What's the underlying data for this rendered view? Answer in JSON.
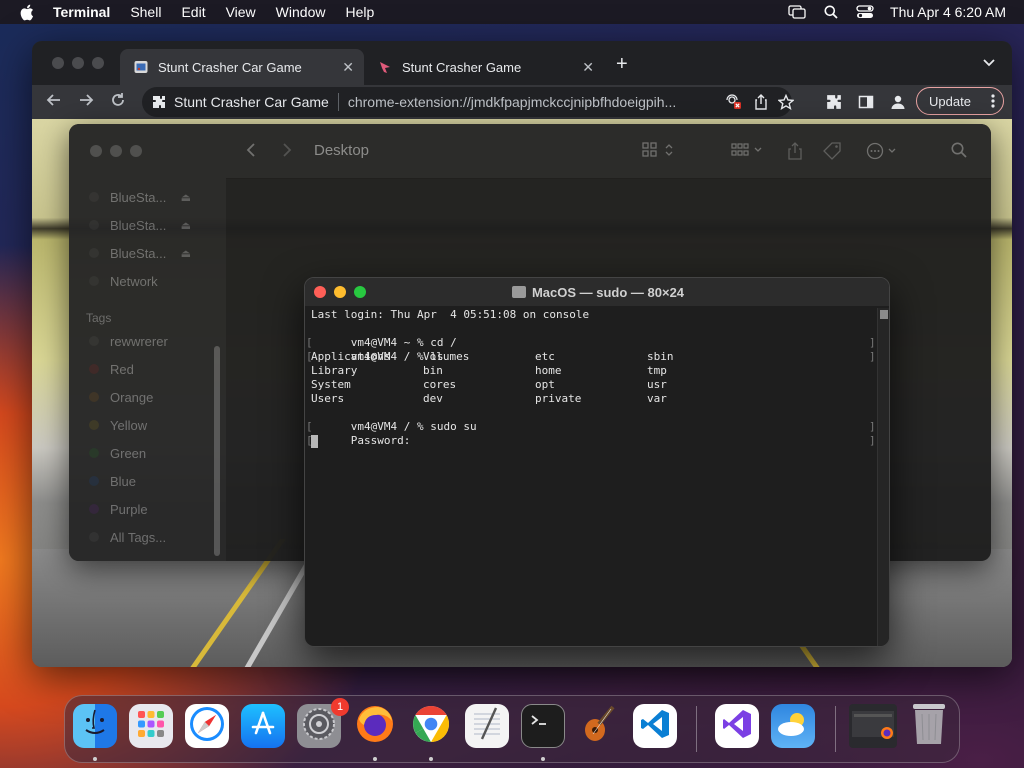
{
  "menubar": {
    "app_name": "Terminal",
    "items": [
      "Shell",
      "Edit",
      "View",
      "Window",
      "Help"
    ],
    "clock": "Thu Apr 4  6:20 AM",
    "icons": [
      "apple-icon",
      "screen-mirroring-icon",
      "search-icon",
      "control-center-icon"
    ]
  },
  "browser": {
    "tabs": [
      {
        "title": "Stunt Crasher Car Game",
        "active": true
      },
      {
        "title": "Stunt Crasher Game",
        "active": false
      }
    ],
    "site_name": "Stunt Crasher Car Game",
    "url": "chrome-extension://jmdkfpapjmckccjnipbfhdoeigpih...",
    "update_label": "Update"
  },
  "finder": {
    "title": "Desktop",
    "locations": [
      {
        "label": "BlueSta..."
      },
      {
        "label": "BlueSta..."
      },
      {
        "label": "BlueSta..."
      },
      {
        "label": "Network"
      }
    ],
    "tags_header": "Tags",
    "tags": [
      {
        "label": "rewwrerer",
        "color": "#2f2f2f"
      },
      {
        "label": "Red",
        "color": "#3a2424"
      },
      {
        "label": "Orange",
        "color": "#3a2f22"
      },
      {
        "label": "Yellow",
        "color": "#393522"
      },
      {
        "label": "Green",
        "color": "#233424"
      },
      {
        "label": "Blue",
        "color": "#222c3a"
      },
      {
        "label": "Purple",
        "color": "#312338"
      },
      {
        "label": "All Tags...",
        "color": "#2f2f2f"
      }
    ]
  },
  "terminal": {
    "title": "MacOS — sudo — 80×24",
    "lines": [
      "Last login: Thu Apr  4 05:51:08 on console",
      "vm4@VM4 ~ % cd /",
      "vm4@VM4 / % ls"
    ],
    "ls_output": [
      [
        "Applications",
        "Volumes",
        "etc",
        "sbin"
      ],
      [
        "Library",
        "bin",
        "home",
        "tmp"
      ],
      [
        "System",
        "cores",
        "opt",
        "usr"
      ],
      [
        "Users",
        "dev",
        "private",
        "var"
      ]
    ],
    "after_lines": [
      "vm4@VM4 / % sudo su",
      "Password:"
    ]
  },
  "dock": {
    "apps": [
      {
        "name": "Finder",
        "icon": "finder-icon",
        "running": true
      },
      {
        "name": "Launchpad",
        "icon": "launchpad-icon",
        "running": false
      },
      {
        "name": "Safari",
        "icon": "safari-icon",
        "running": false
      },
      {
        "name": "App Store",
        "icon": "app-store-icon",
        "running": false
      },
      {
        "name": "System Settings",
        "icon": "settings-icon",
        "running": false,
        "badge": "1"
      },
      {
        "name": "Firefox",
        "icon": "firefox-icon",
        "running": true
      },
      {
        "name": "Chrome",
        "icon": "chrome-icon",
        "running": true
      },
      {
        "name": "TextEdit",
        "icon": "textedit-icon",
        "running": false
      },
      {
        "name": "Terminal",
        "icon": "terminal-icon",
        "running": true
      },
      {
        "name": "GarageBand",
        "icon": "garageband-icon",
        "running": false
      },
      {
        "name": "Visual Studio Code",
        "icon": "vscode-icon",
        "running": false
      },
      {
        "name": "Visual Studio",
        "icon": "visual-studio-icon",
        "running": false
      },
      {
        "name": "Weather",
        "icon": "weather-icon",
        "running": false
      },
      {
        "name": "Minimized Window",
        "icon": "minimized-window-icon",
        "running": false
      },
      {
        "name": "Trash",
        "icon": "trash-icon",
        "running": false
      }
    ]
  }
}
